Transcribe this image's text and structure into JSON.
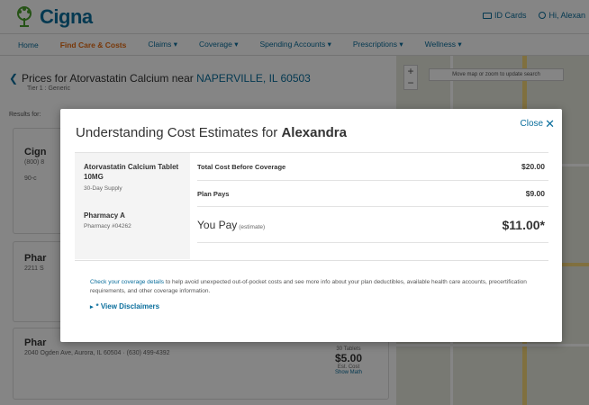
{
  "header": {
    "logo_text": "Cigna",
    "id_cards": "ID Cards",
    "greeting": "Hi, Alexan"
  },
  "nav": {
    "items": [
      "Home",
      "Find Care & Costs",
      "Claims ▾",
      "Coverage ▾",
      "Spending Accounts ▾",
      "Prescriptions ▾",
      "Wellness ▾"
    ]
  },
  "background": {
    "prices_prefix": "Prices for ",
    "drug": "Atorvastatin Calcium",
    "near": " near ",
    "location": "NAPERVILLE, IL 60503",
    "tier": "Tier 1 : Generic",
    "results_for": "Results for:",
    "card1_title": "Cign",
    "card1_sub": "(800) 8",
    "card1_line": "90-c",
    "card2_title": "Phar",
    "card2_sub": "2211 S",
    "card3_title": "Phar",
    "card3_sub": "2040 Ogden Ave, Aurora, IL 60504 · (630) 499-4392",
    "price_label": "30 Tablets",
    "price_amount": "$5.00",
    "price_sub": "Est. Cost",
    "price_link": "Show Math",
    "map_tip": "Move map or zoom to update search"
  },
  "modal": {
    "title_prefix": "Understanding Cost Estimates for ",
    "title_name": "Alexandra",
    "close_label": "Close",
    "drug_name": "Atorvastatin Calcium Tablet 10MG",
    "supply": "30-Day Supply",
    "pharmacy_name": "Pharmacy A",
    "pharmacy_num": "Pharmacy #04262",
    "total_label": "Total Cost Before Coverage",
    "total_value": "$20.00",
    "plan_label": "Plan Pays",
    "plan_value": "$9.00",
    "you_label": "You Pay",
    "you_est": "(estimate)",
    "you_value": "$11.00*",
    "info_link": "Check your coverage details",
    "info_text": " to help avoid unexpected out-of-pocket costs and see more info about your plan deductibles, available health care accounts, precertification requirements, and other coverage information.",
    "disclaimers_label": "* View Disclaimers"
  }
}
